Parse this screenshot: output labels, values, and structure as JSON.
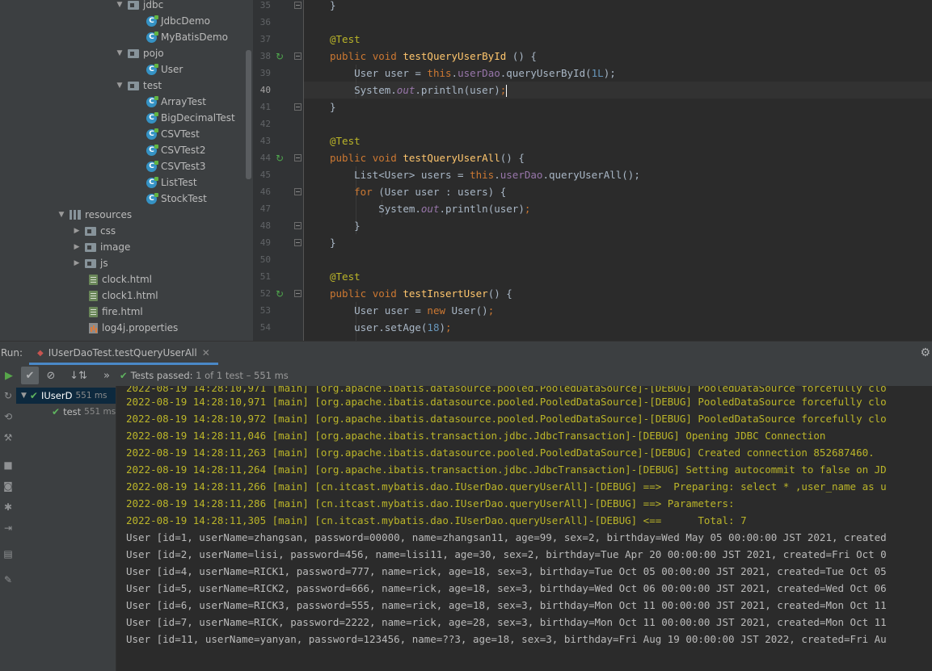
{
  "project_tree": {
    "items": [
      {
        "label": "jdbc",
        "kind": "package",
        "expanded": true
      },
      {
        "label": "JdbcDemo",
        "kind": "class"
      },
      {
        "label": "MyBatisDemo",
        "kind": "class"
      },
      {
        "label": "pojo",
        "kind": "package",
        "expanded": true
      },
      {
        "label": "User",
        "kind": "class"
      },
      {
        "label": "test",
        "kind": "package",
        "expanded": true
      },
      {
        "label": "ArrayTest",
        "kind": "class"
      },
      {
        "label": "BigDecimalTest",
        "kind": "class"
      },
      {
        "label": "CSVTest",
        "kind": "class"
      },
      {
        "label": "CSVTest2",
        "kind": "class"
      },
      {
        "label": "CSVTest3",
        "kind": "class"
      },
      {
        "label": "ListTest",
        "kind": "class"
      },
      {
        "label": "StockTest",
        "kind": "class"
      },
      {
        "label": "resources",
        "kind": "resources",
        "expanded": true
      },
      {
        "label": "css",
        "kind": "folder",
        "expanded": false
      },
      {
        "label": "image",
        "kind": "folder",
        "expanded": false
      },
      {
        "label": "js",
        "kind": "folder",
        "expanded": false
      },
      {
        "label": "clock.html",
        "kind": "html"
      },
      {
        "label": "clock1.html",
        "kind": "html"
      },
      {
        "label": "fire.html",
        "kind": "html"
      },
      {
        "label": "log4j.properties",
        "kind": "properties"
      }
    ]
  },
  "editor": {
    "line_numbers": [
      "35",
      "36",
      "37",
      "38",
      "39",
      "40",
      "41",
      "42",
      "43",
      "44",
      "45",
      "46",
      "47",
      "48",
      "49",
      "50",
      "51",
      "52",
      "53",
      "54"
    ],
    "current_line": "40",
    "code": {
      "l35": "}",
      "l37_ann": "@Test",
      "l38_kw1": "public",
      "l38_kw2": "void",
      "l38_fn": "testQueryUserById",
      "l38_rest": " () {",
      "l39_a": "User user = ",
      "l39_this": "this",
      "l39_dot": ".",
      "l39_fld": "userDao",
      "l39_b": ".queryUserById(",
      "l39_num": "1L",
      "l39_c": ");",
      "l40_a": "System.",
      "l40_out": "out",
      "l40_b": ".println(user)",
      "l40_semi": ";",
      "l41": "}",
      "l43_ann": "@Test",
      "l44_kw1": "public",
      "l44_kw2": "void",
      "l44_fn": "testQueryUserAll",
      "l44_rest": "() {",
      "l45_a": "List<User> users = ",
      "l45_this": "this",
      "l45_dot": ".",
      "l45_fld": "userDao",
      "l45_b": ".queryUserAll();",
      "l46_kw": "for",
      "l46_a": " (User user : users) {",
      "l47_a": "System.",
      "l47_out": "out",
      "l47_b": ".println(user)",
      "l47_semi": ";",
      "l48": "}",
      "l49": "}",
      "l51_ann": "@Test",
      "l52_kw1": "public",
      "l52_kw2": "void",
      "l52_fn": "testInsertUser",
      "l52_rest": "() {",
      "l53_a": "User user = ",
      "l53_new": "new",
      "l53_b": " User()",
      "l53_semi": ";",
      "l54_a": "user.setAge(",
      "l54_num": "18",
      "l54_b": ")",
      "l54_semi": ";"
    }
  },
  "run_panel": {
    "label": "Run:",
    "tab_title": "IUserDaoTest.testQueryUserAll",
    "tab_close": "✕",
    "tests_passed": "Tests passed:",
    "tests_detail": "1 of 1 test – 551 ms",
    "test_tree": [
      {
        "label": "IUserD",
        "time": "551 ms"
      },
      {
        "label": "test",
        "time": "551 ms"
      }
    ],
    "console": [
      {
        "type": "log",
        "text": "2022-08-19 14:28:10,971 [main] [org.apache.ibatis.datasource.pooled.PooledDataSource]-[DEBUG] PooledDataSource forcefully clo"
      },
      {
        "type": "log",
        "text": "2022-08-19 14:28:10,971 [main] [org.apache.ibatis.datasource.pooled.PooledDataSource]-[DEBUG] PooledDataSource forcefully clo"
      },
      {
        "type": "log",
        "text": "2022-08-19 14:28:10,972 [main] [org.apache.ibatis.datasource.pooled.PooledDataSource]-[DEBUG] PooledDataSource forcefully clo"
      },
      {
        "type": "log",
        "text": "2022-08-19 14:28:11,046 [main] [org.apache.ibatis.transaction.jdbc.JdbcTransaction]-[DEBUG] Opening JDBC Connection"
      },
      {
        "type": "log",
        "text": "2022-08-19 14:28:11,263 [main] [org.apache.ibatis.datasource.pooled.PooledDataSource]-[DEBUG] Created connection 852687460."
      },
      {
        "type": "log",
        "text": "2022-08-19 14:28:11,264 [main] [org.apache.ibatis.transaction.jdbc.JdbcTransaction]-[DEBUG] Setting autocommit to false on JD"
      },
      {
        "type": "log",
        "text": "2022-08-19 14:28:11,266 [main] [cn.itcast.mybatis.dao.IUserDao.queryUserAll]-[DEBUG] ==>  Preparing: select * ,user_name as u"
      },
      {
        "type": "log",
        "text": "2022-08-19 14:28:11,286 [main] [cn.itcast.mybatis.dao.IUserDao.queryUserAll]-[DEBUG] ==> Parameters: "
      },
      {
        "type": "log",
        "text": "2022-08-19 14:28:11,305 [main] [cn.itcast.mybatis.dao.IUserDao.queryUserAll]-[DEBUG] <==      Total: 7"
      },
      {
        "type": "out",
        "text": "User [id=1, userName=zhangsan, password=00000, name=zhangsan11, age=99, sex=2, birthday=Wed May 05 00:00:00 JST 2021, created"
      },
      {
        "type": "out",
        "text": "User [id=2, userName=lisi, password=456, name=lisi11, age=30, sex=2, birthday=Tue Apr 20 00:00:00 JST 2021, created=Fri Oct 0"
      },
      {
        "type": "out",
        "text": "User [id=4, userName=RICK1, password=777, name=rick, age=18, sex=3, birthday=Tue Oct 05 00:00:00 JST 2021, created=Tue Oct 05"
      },
      {
        "type": "out",
        "text": "User [id=5, userName=RICK2, password=666, name=rick, age=18, sex=3, birthday=Wed Oct 06 00:00:00 JST 2021, created=Wed Oct 06"
      },
      {
        "type": "out",
        "text": "User [id=6, userName=RICK3, password=555, name=rick, age=18, sex=3, birthday=Mon Oct 11 00:00:00 JST 2021, created=Mon Oct 11"
      },
      {
        "type": "out",
        "text": "User [id=7, userName=RICK, password=2222, name=rick, age=28, sex=3, birthday=Mon Oct 11 00:00:00 JST 2021, created=Mon Oct 11"
      },
      {
        "type": "out",
        "text": "User [id=11, userName=yanyan, password=123456, name=??3, age=18, sex=3, birthday=Fri Aug 19 00:00:00 JST 2022, created=Fri Au"
      },
      {
        "type": "out",
        "text": ""
      }
    ]
  },
  "icons": {
    "run": "play-icon",
    "settings": "gear-icon",
    "pass": "check-icon"
  },
  "colors": {
    "keyword": "#cc7832",
    "annotation": "#bbb529",
    "method": "#ffc66d",
    "field": "#9876aa",
    "number": "#6897bb",
    "pass": "#5fb35f",
    "log": "#bbb529"
  }
}
